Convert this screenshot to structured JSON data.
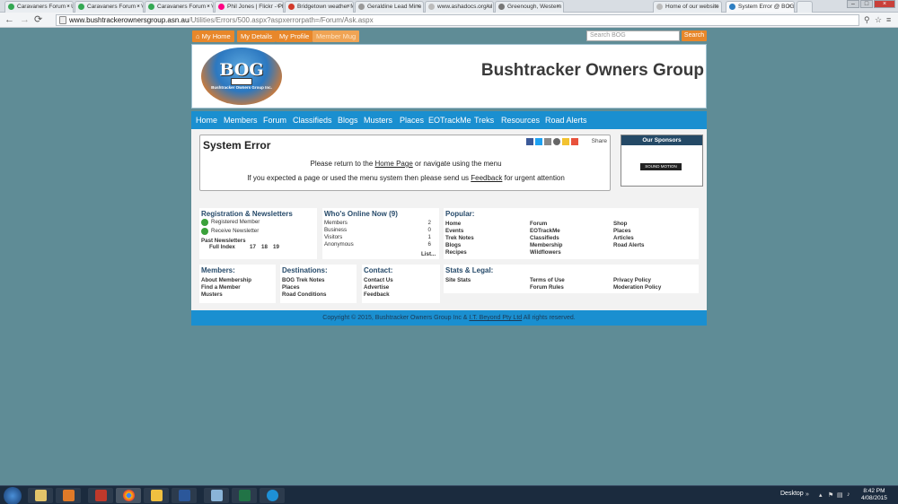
{
  "browser": {
    "tabs": [
      {
        "title": "Caravaners Forum • U",
        "fav_color": "#34a853"
      },
      {
        "title": "Caravaners Forum • V",
        "fav_color": "#34a853"
      },
      {
        "title": "Caravaners Forum • V",
        "fav_color": "#34a853"
      },
      {
        "title": "Phil Jones | Flickr - Ph",
        "fav_color": "#ff0084"
      },
      {
        "title": "Bridgetown weather fo",
        "fav_color": "#d23a2a"
      },
      {
        "title": "Geraldine Lead Mine",
        "fav_color": "#999999"
      },
      {
        "title": "www.ashadocs.org/ul",
        "fav_color": "#bbbbbb"
      },
      {
        "title": "Greenough, Western",
        "fav_color": "#777777"
      },
      {
        "title": "Home of our website",
        "fav_color": "#bbbbbb"
      },
      {
        "title": "System Error @ BOG",
        "fav_color": "#2d7ec2"
      }
    ],
    "url_host": "www.bushtrackerownersgroup.asn.au",
    "url_path": "/Utilities/Errors/500.aspx?aspxerrorpath=/Forum/Ask.aspx"
  },
  "top_buttons": {
    "my_home": "My Home",
    "my_details": "My Details",
    "my_profile": "My Profile",
    "member_mug": "Member Mug"
  },
  "search": {
    "placeholder": "Search BOG",
    "button": "Search"
  },
  "header": {
    "logo_text": "BOG",
    "logo_sub": "Bushtracker Owners Group Inc.",
    "site_title": "Bushtracker Owners Group"
  },
  "nav": [
    "Home",
    "Members",
    "Forum",
    "Classifieds",
    "Blogs",
    "Musters",
    "Places",
    "EOTrackMe",
    "Treks",
    "Resources",
    "Road Alerts"
  ],
  "error": {
    "title": "System Error",
    "share_label": "Share",
    "line1_pre": "Please return to the ",
    "line1_link": "Home Page",
    "line1_post": " or navigate using the menu",
    "line2_pre": "If you expected a page or used the menu system then please send us ",
    "line2_link": "Feedback",
    "line2_post": " for urgent attention"
  },
  "sponsors": {
    "title": "Our Sponsors",
    "logo_text": "SOUND MOTION"
  },
  "registration": {
    "title": "Registration & Newsletters",
    "registered": "Registered Member",
    "receive": "Receive Newsletter",
    "past": "Past Newsletters",
    "full_index": "Full Index",
    "issues": [
      "17",
      "18",
      "19"
    ]
  },
  "online": {
    "title": "Who's Online Now (9)",
    "rows": [
      {
        "label": "Members",
        "count": "2"
      },
      {
        "label": "Business",
        "count": "0"
      },
      {
        "label": "Visitors",
        "count": "1"
      },
      {
        "label": "Anonymous",
        "count": "6"
      }
    ],
    "list_link": "List..."
  },
  "popular": {
    "title": "Popular:",
    "col1": [
      "Home",
      "Events",
      "Trek Notes",
      "Blogs",
      "Recipes"
    ],
    "col2": [
      "Forum",
      "EOTrackMe",
      "Classifieds",
      "Membership",
      "Wildflowers"
    ],
    "col3": [
      "Shop",
      "Places",
      "Articles",
      "Road Alerts"
    ]
  },
  "members_panel": {
    "title": "Members:",
    "items": [
      "About Membership",
      "Find a Member",
      "Musters"
    ]
  },
  "destinations": {
    "title": "Destinations:",
    "items": [
      "BOG Trek Notes",
      "Places",
      "Road Conditions"
    ]
  },
  "contact": {
    "title": "Contact:",
    "items": [
      "Contact Us",
      "Advertise",
      "Feedback"
    ]
  },
  "stats": {
    "title": "Stats & Legal:",
    "items": [
      "Site Stats",
      "Terms of Use",
      "Forum Rules",
      "Privacy Policy",
      "Moderation Policy"
    ]
  },
  "footer": {
    "pre": "Copyright © 2015, Bushtracker Owners Group Inc & ",
    "link": "I.T. Beyond Pty Ltd",
    "post": " All rights reserved."
  },
  "taskbar": {
    "desktop_label": "Desktop",
    "time": "8:42 PM",
    "date": "4/08/2015"
  }
}
